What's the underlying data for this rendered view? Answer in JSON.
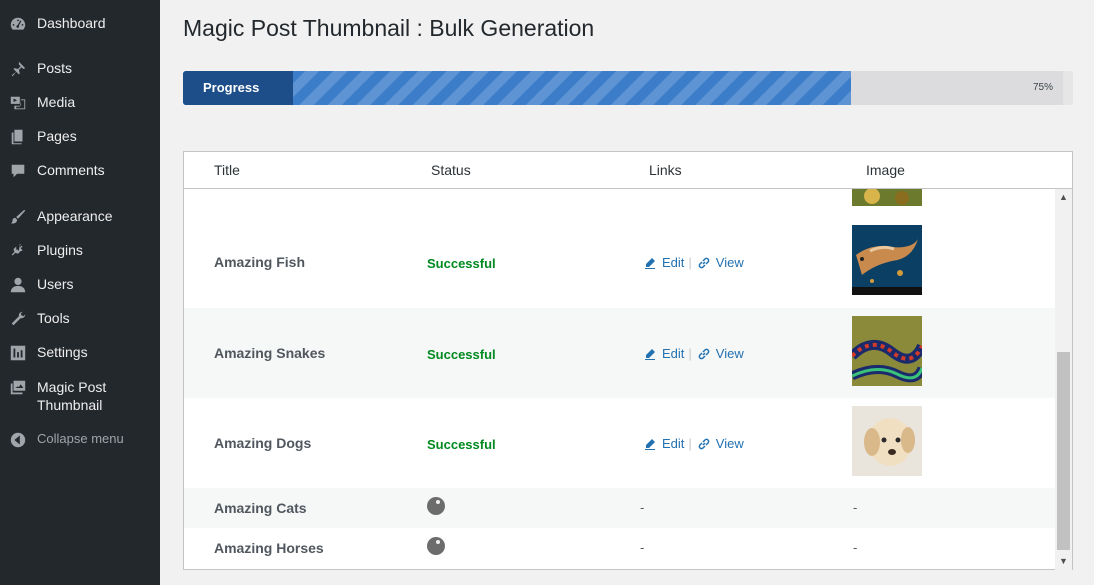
{
  "sidebar": {
    "items": [
      {
        "label": "Dashboard",
        "icon": "dashboard-icon"
      },
      {
        "label": "Posts",
        "icon": "pin-icon"
      },
      {
        "label": "Media",
        "icon": "media-icon"
      },
      {
        "label": "Pages",
        "icon": "pages-icon"
      },
      {
        "label": "Comments",
        "icon": "comment-icon"
      },
      {
        "label": "Appearance",
        "icon": "brush-icon"
      },
      {
        "label": "Plugins",
        "icon": "plug-icon"
      },
      {
        "label": "Users",
        "icon": "user-icon"
      },
      {
        "label": "Tools",
        "icon": "wrench-icon"
      },
      {
        "label": "Settings",
        "icon": "sliders-icon"
      },
      {
        "label": "Magic Post",
        "label2": "Thumbnail",
        "icon": "gallery-icon"
      },
      {
        "label": "Collapse menu",
        "icon": "collapse-icon"
      }
    ]
  },
  "page": {
    "title": "Magic Post Thumbnail : Bulk Generation"
  },
  "progress": {
    "label": "Progress",
    "percent_text": "75%",
    "value": 0.75
  },
  "table": {
    "headers": {
      "title": "Title",
      "status": "Status",
      "links": "Links",
      "image": "Image"
    },
    "rows": [
      {
        "title": "Amazing Fish",
        "status": "Successful",
        "edit": "Edit",
        "view": "View",
        "image": "fish-image"
      },
      {
        "title": "Amazing Snakes",
        "status": "Successful",
        "edit": "Edit",
        "view": "View",
        "image": "snake-image"
      },
      {
        "title": "Amazing Dogs",
        "status": "Successful",
        "edit": "Edit",
        "view": "View",
        "image": "dog-image"
      },
      {
        "title": "Amazing Cats",
        "links": "-",
        "image": "-"
      },
      {
        "title": "Amazing Horses",
        "links": "-",
        "image": "-"
      }
    ]
  },
  "colors": {
    "sidebar_bg": "#23282d",
    "progress_label_bg": "#1d4e89",
    "progress_fill": "#3b7dc9",
    "status_success": "#008a20",
    "link": "#2271b1"
  }
}
